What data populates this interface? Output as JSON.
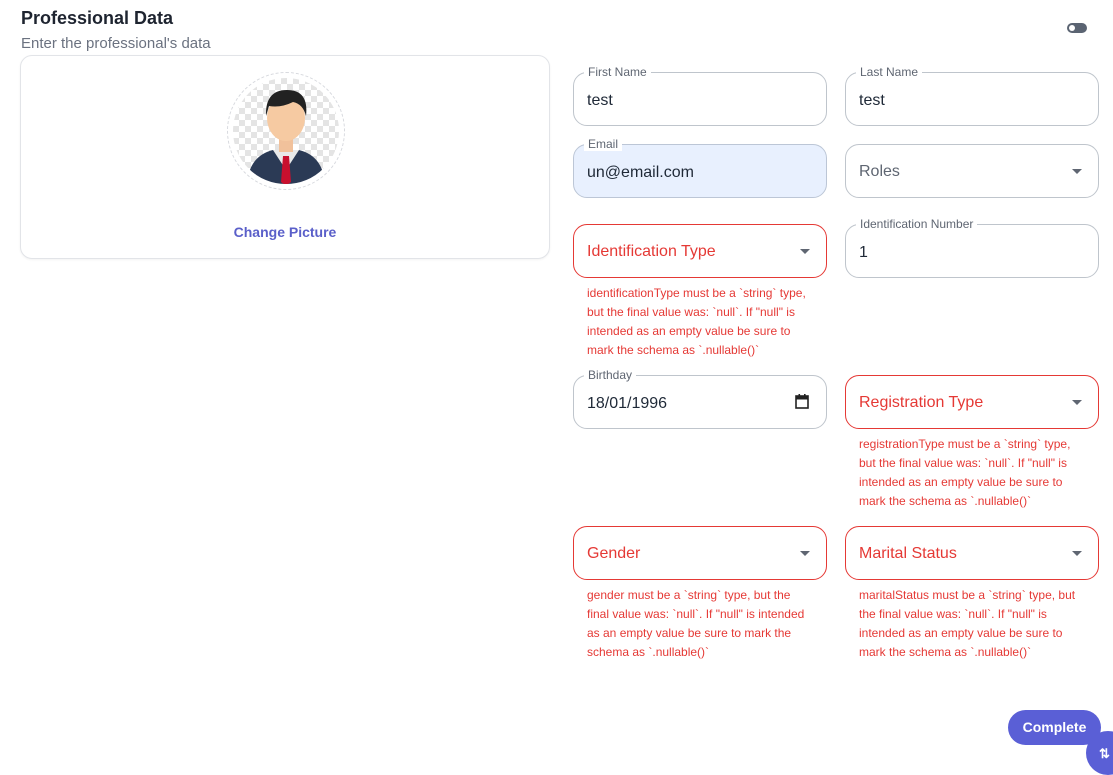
{
  "header": {
    "title": "Professional Data",
    "subtitle": "Enter the professional's data"
  },
  "toggle": {
    "state": "off"
  },
  "profile": {
    "change_picture_label": "Change Picture",
    "avatar_icon": "user-avatar"
  },
  "form": {
    "first_name": {
      "label": "First Name",
      "value": "test"
    },
    "last_name": {
      "label": "Last Name",
      "value": "test"
    },
    "email": {
      "label": "Email",
      "value": "un@email.com"
    },
    "roles": {
      "placeholder": "Roles"
    },
    "identification_type": {
      "placeholder": "Identification Type",
      "error": "identificationType must be a `string` type, but the final value was: `null`. If \"null\" is intended as an empty value be sure to mark the schema as `.nullable()`"
    },
    "identification_number": {
      "label": "Identification Number",
      "value": "1"
    },
    "birthday": {
      "label": "Birthday",
      "value": "18/01/1996",
      "icon": "calendar-icon"
    },
    "registration_type": {
      "placeholder": "Registration Type",
      "error": "registrationType must be a `string` type, but the final value was: `null`. If \"null\" is intended as an empty value be sure to mark the schema as `.nullable()`"
    },
    "gender": {
      "placeholder": "Gender",
      "error": "gender must be a `string` type, but the final value was: `null`. If \"null\" is intended as an empty value be sure to mark the schema as `.nullable()`"
    },
    "marital_status": {
      "placeholder": "Marital Status",
      "error": "maritalStatus must be a `string` type, but the final value was: `null`. If \"null\" is intended as an empty value be sure to mark the schema as `.nullable()`"
    }
  },
  "actions": {
    "complete_label": "Complete",
    "fab_icon": "sort-arrows-icon",
    "fab_glyph": "⇅"
  },
  "colors": {
    "accent": "#5a5fd6",
    "error": "#e53935",
    "autofill": "#e8f0fe"
  }
}
